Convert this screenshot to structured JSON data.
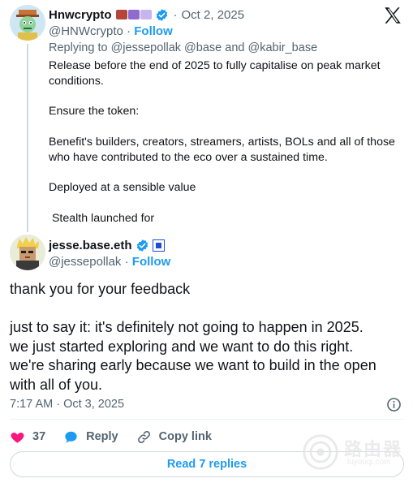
{
  "parent_tweet": {
    "display_name": "Hnwcrypto",
    "handle": "@HNWcrypto",
    "separator": "·",
    "date": "Oct 2, 2025",
    "follow_label": "Follow",
    "replying_prefix": "Replying to",
    "replying_users": "@jessepollak @base and @kabir_base",
    "paragraphs": [
      "Release before the end of 2025 to fully capitalise on peak market conditions.",
      "Ensure the token:",
      "Benefit's builders, creators, streamers, artists, BOLs and all of those who have contributed to the eco over a sustained time.",
      "Deployed at a sensible value",
      " Stealth launched for"
    ]
  },
  "main_tweet": {
    "display_name": "jesse.base.eth",
    "handle": "@jessepollak",
    "separator": "·",
    "follow_label": "Follow",
    "body": {
      "para1": "thank you for your feedback",
      "lines": [
        "just to say it: it's definitely not going to happen in 2025.",
        "we just started exploring and we want to do this right.",
        "we're sharing early because we want to build in the open",
        "with all of you."
      ]
    },
    "timestamp": "7:17 AM · Oct 3, 2025",
    "likes": "37",
    "reply_label": "Reply",
    "copy_link_label": "Copy link",
    "read_replies_label": "Read 7 replies"
  },
  "watermark": {
    "text": "路由器",
    "sub": "luyouqi.com"
  },
  "colors": {
    "accent": "#1d9bf0",
    "like": "#f91880",
    "muted": "#536471",
    "text": "#0f1419"
  },
  "icons": [
    "x-logo-icon",
    "verified-badge-icon",
    "heart-icon",
    "reply-bubble-icon",
    "link-icon",
    "info-icon"
  ]
}
